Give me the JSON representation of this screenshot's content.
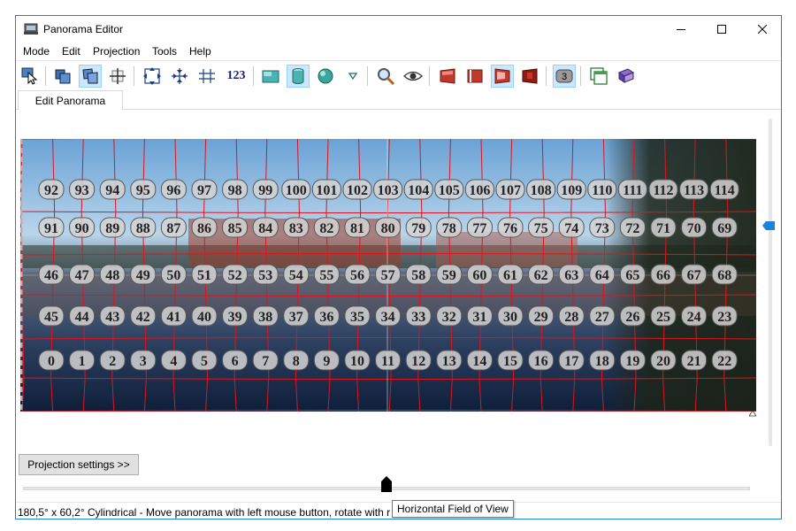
{
  "window": {
    "title": "Panorama Editor"
  },
  "menu": [
    "Mode",
    "Edit",
    "Projection",
    "Tools",
    "Help"
  ],
  "toolbar": {
    "number_label": "123",
    "overlap_badge": "3",
    "icons": [
      "pointer-icon",
      "images-icon",
      "move-images-icon",
      "crosshair-icon",
      "fit-icon",
      "center-icon",
      "straighten-icon",
      "numbers-icon",
      "rectilinear-icon",
      "cylindrical-icon",
      "spherical-icon",
      "dropdown-icon",
      "zoom-icon",
      "preview-icon",
      "red-frame-icon-1",
      "red-frame-icon-2",
      "red-frame-icon-3",
      "red-frame-icon-4",
      "overlap-icon",
      "window-icon",
      "book-icon"
    ],
    "active": [
      "move-images-icon",
      "cylindrical-icon",
      "red-frame-icon-3",
      "overlap-icon"
    ]
  },
  "tabs": [
    {
      "label": "Edit Panorama",
      "selected": true
    }
  ],
  "panorama": {
    "rows": [
      [
        "92",
        "93",
        "94",
        "95",
        "96",
        "97",
        "98",
        "99",
        "100",
        "101",
        "102",
        "103",
        "104",
        "105",
        "106",
        "107",
        "108",
        "109",
        "110",
        "111",
        "112",
        "113",
        "114"
      ],
      [
        "91",
        "90",
        "89",
        "88",
        "87",
        "86",
        "85",
        "84",
        "83",
        "82",
        "81",
        "80",
        "79",
        "78",
        "77",
        "76",
        "75",
        "74",
        "73",
        "72",
        "71",
        "70",
        "69"
      ],
      [
        "46",
        "47",
        "48",
        "49",
        "50",
        "51",
        "52",
        "53",
        "54",
        "55",
        "56",
        "57",
        "58",
        "59",
        "60",
        "61",
        "62",
        "63",
        "64",
        "65",
        "66",
        "67",
        "68"
      ],
      [
        "45",
        "44",
        "43",
        "42",
        "41",
        "40",
        "39",
        "38",
        "37",
        "36",
        "35",
        "34",
        "33",
        "32",
        "31",
        "30",
        "29",
        "28",
        "27",
        "26",
        "25",
        "24",
        "23"
      ],
      [
        "0",
        "1",
        "2",
        "3",
        "4",
        "5",
        "6",
        "7",
        "8",
        "9",
        "10",
        "11",
        "12",
        "13",
        "14",
        "15",
        "16",
        "17",
        "18",
        "19",
        "20",
        "21",
        "22"
      ]
    ],
    "grid_color": "#e0141e"
  },
  "buttons": {
    "projection_settings": "Projection settings >>"
  },
  "status": {
    "text": "180,5° x 60,2° Cylindrical - Move panorama with left mouse button, rotate with r",
    "tooltip": "Horizontal Field of View"
  },
  "colors": {
    "accent": "#1883d7",
    "selection": "#cce8ff"
  }
}
